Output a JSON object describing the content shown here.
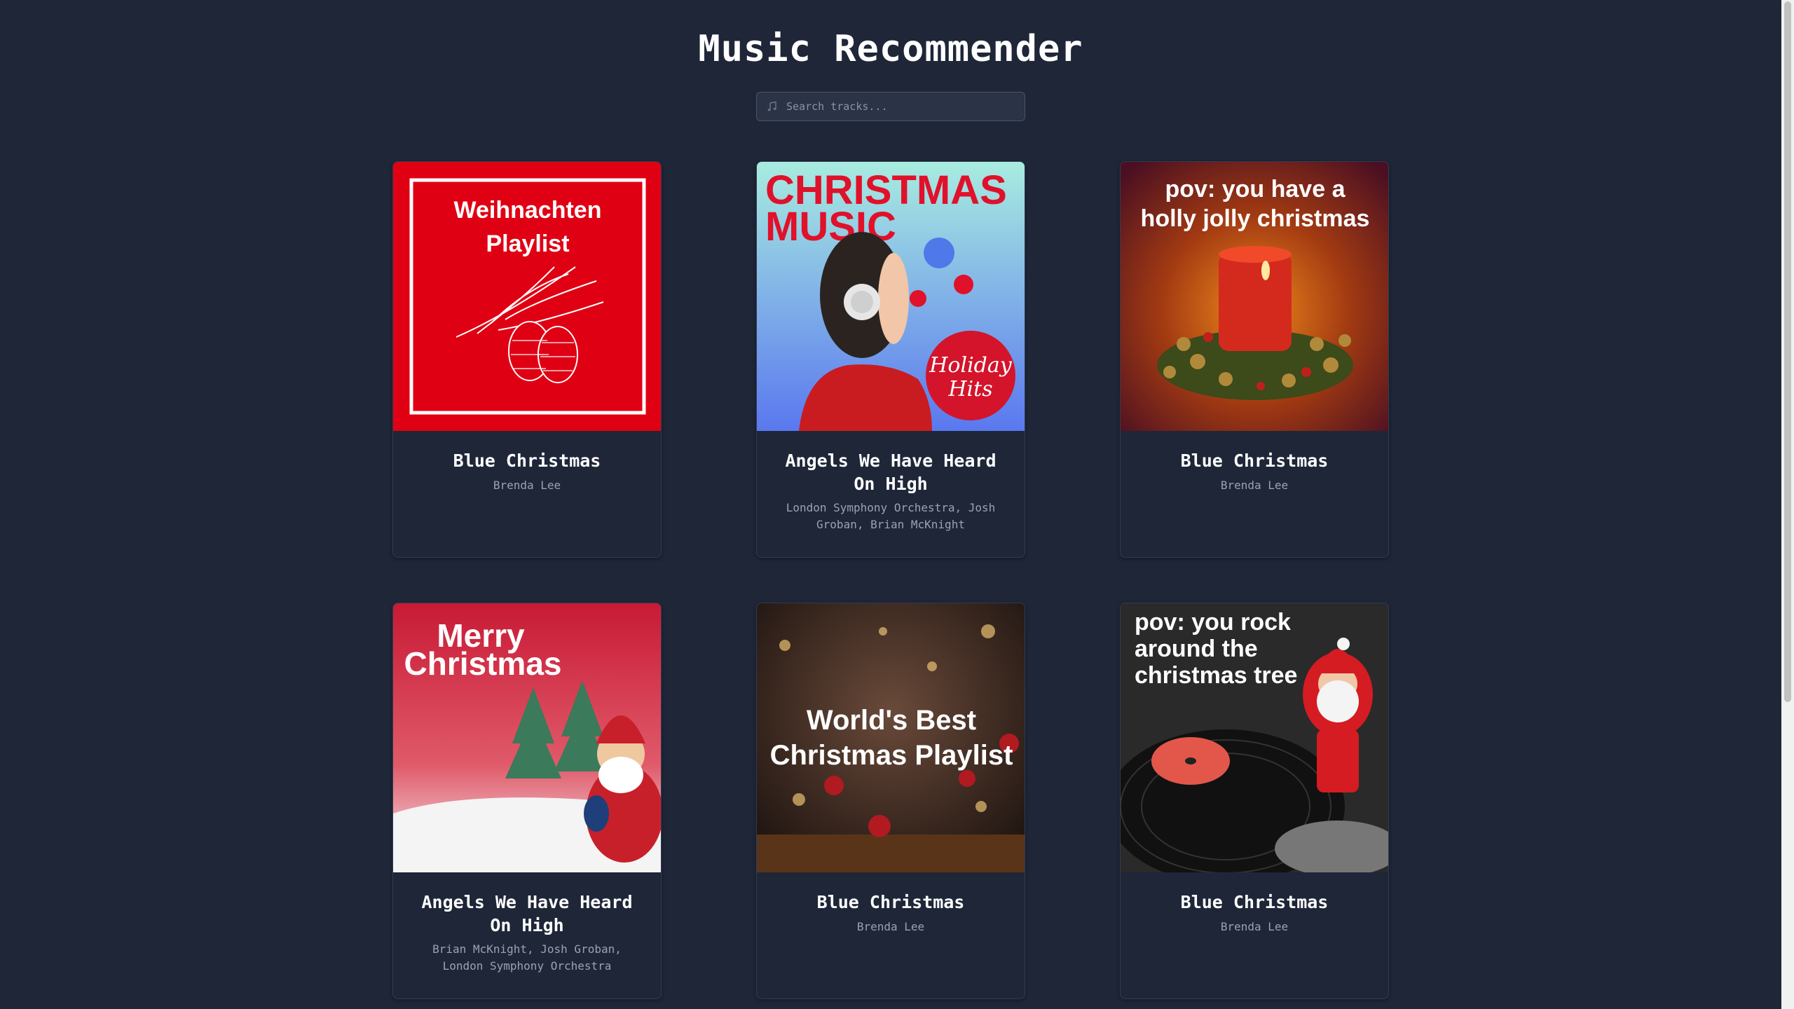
{
  "app": {
    "title": "Music Recommender"
  },
  "search": {
    "placeholder": "Search tracks...",
    "value": "",
    "icon": "music-note-icon"
  },
  "tracks": [
    {
      "title": "Blue Christmas",
      "artist": "Brenda Lee",
      "cover_text": [
        "Weihnachten",
        "Playlist"
      ],
      "cover_color": "#e00013"
    },
    {
      "title": "Angels We Have Heard On High",
      "artist": "London Symphony Orchestra, Josh Groban, Brian McKnight",
      "cover_text": [
        "CHRISTMAS",
        "MUSIC"
      ],
      "cover_badge": [
        "Holiday",
        "Hits"
      ],
      "cover_color": "#e0112b"
    },
    {
      "title": "Blue Christmas",
      "artist": "Brenda Lee",
      "cover_text": [
        "pov: you have a",
        "holly jolly christmas"
      ],
      "cover_color": "#8a2a12"
    },
    {
      "title": "Angels We Have Heard On High",
      "artist": "Brian McKnight, Josh Groban, London Symphony Orchestra",
      "cover_text": [
        "Merry",
        "Christmas"
      ],
      "cover_color": "#c81a35"
    },
    {
      "title": "Blue Christmas",
      "artist": "Brenda Lee",
      "cover_text": [
        "World's Best",
        "Christmas Playlist"
      ],
      "cover_color": "#3a2418"
    },
    {
      "title": "Blue Christmas",
      "artist": "Brenda Lee",
      "cover_text": [
        "pov: you rock",
        "around the",
        "christmas tree"
      ],
      "cover_color": "#2a2a2a"
    }
  ]
}
